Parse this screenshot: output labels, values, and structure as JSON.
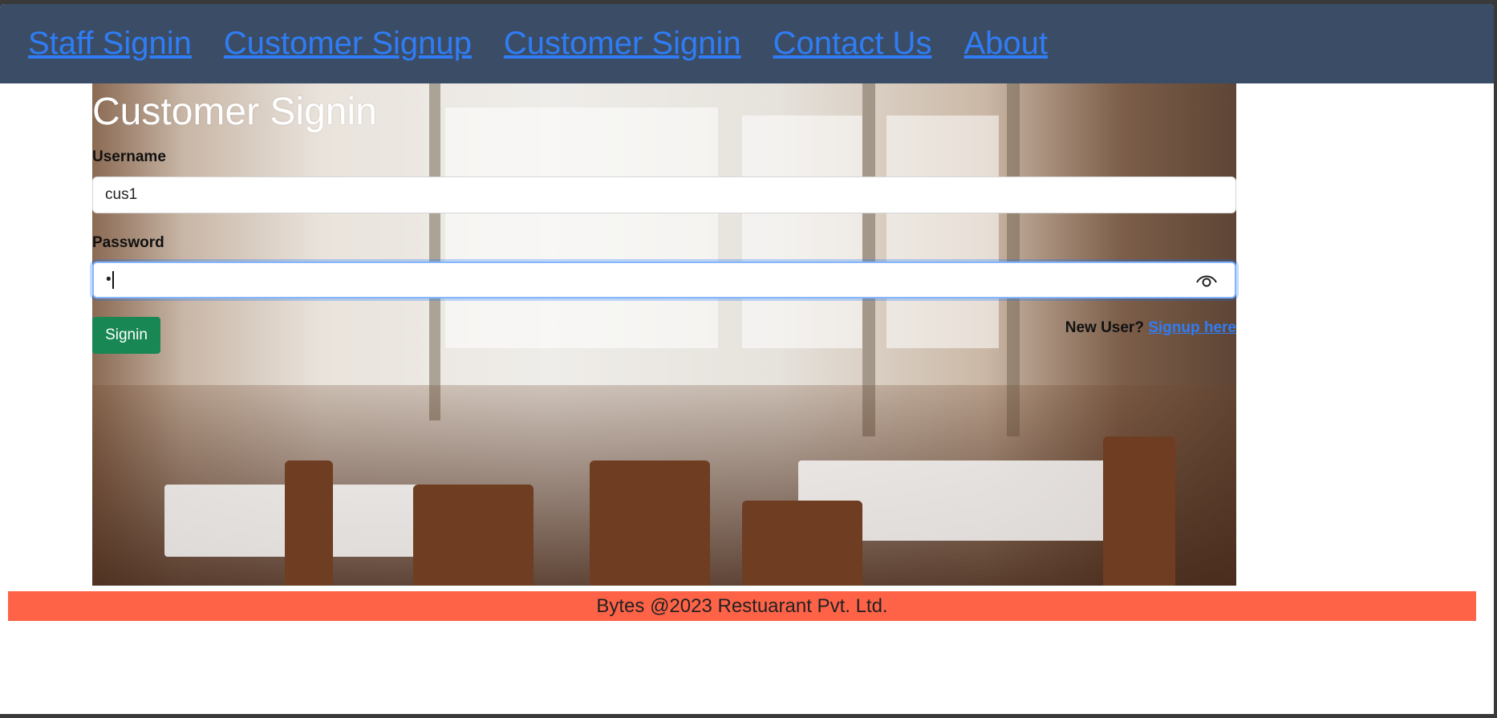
{
  "nav": {
    "items": [
      {
        "label": "Staff Signin"
      },
      {
        "label": "Customer Signup"
      },
      {
        "label": "Customer Signin"
      },
      {
        "label": "Contact Us"
      },
      {
        "label": "About"
      }
    ],
    "link_color": "#2f7df6",
    "background": "#3b4d66"
  },
  "form": {
    "title": "Customer Signin",
    "username_label": "Username",
    "username_value": "cus1",
    "password_label": "Password",
    "password_value": "•",
    "signin_button": "Signin",
    "new_user_text": "New User?",
    "signup_link": "Signup here"
  },
  "footer": {
    "text": "Bytes @2023 Restuarant Pvt. Ltd.",
    "background": "#ff6347"
  },
  "icons": {
    "password_toggle": "eye-icon"
  }
}
